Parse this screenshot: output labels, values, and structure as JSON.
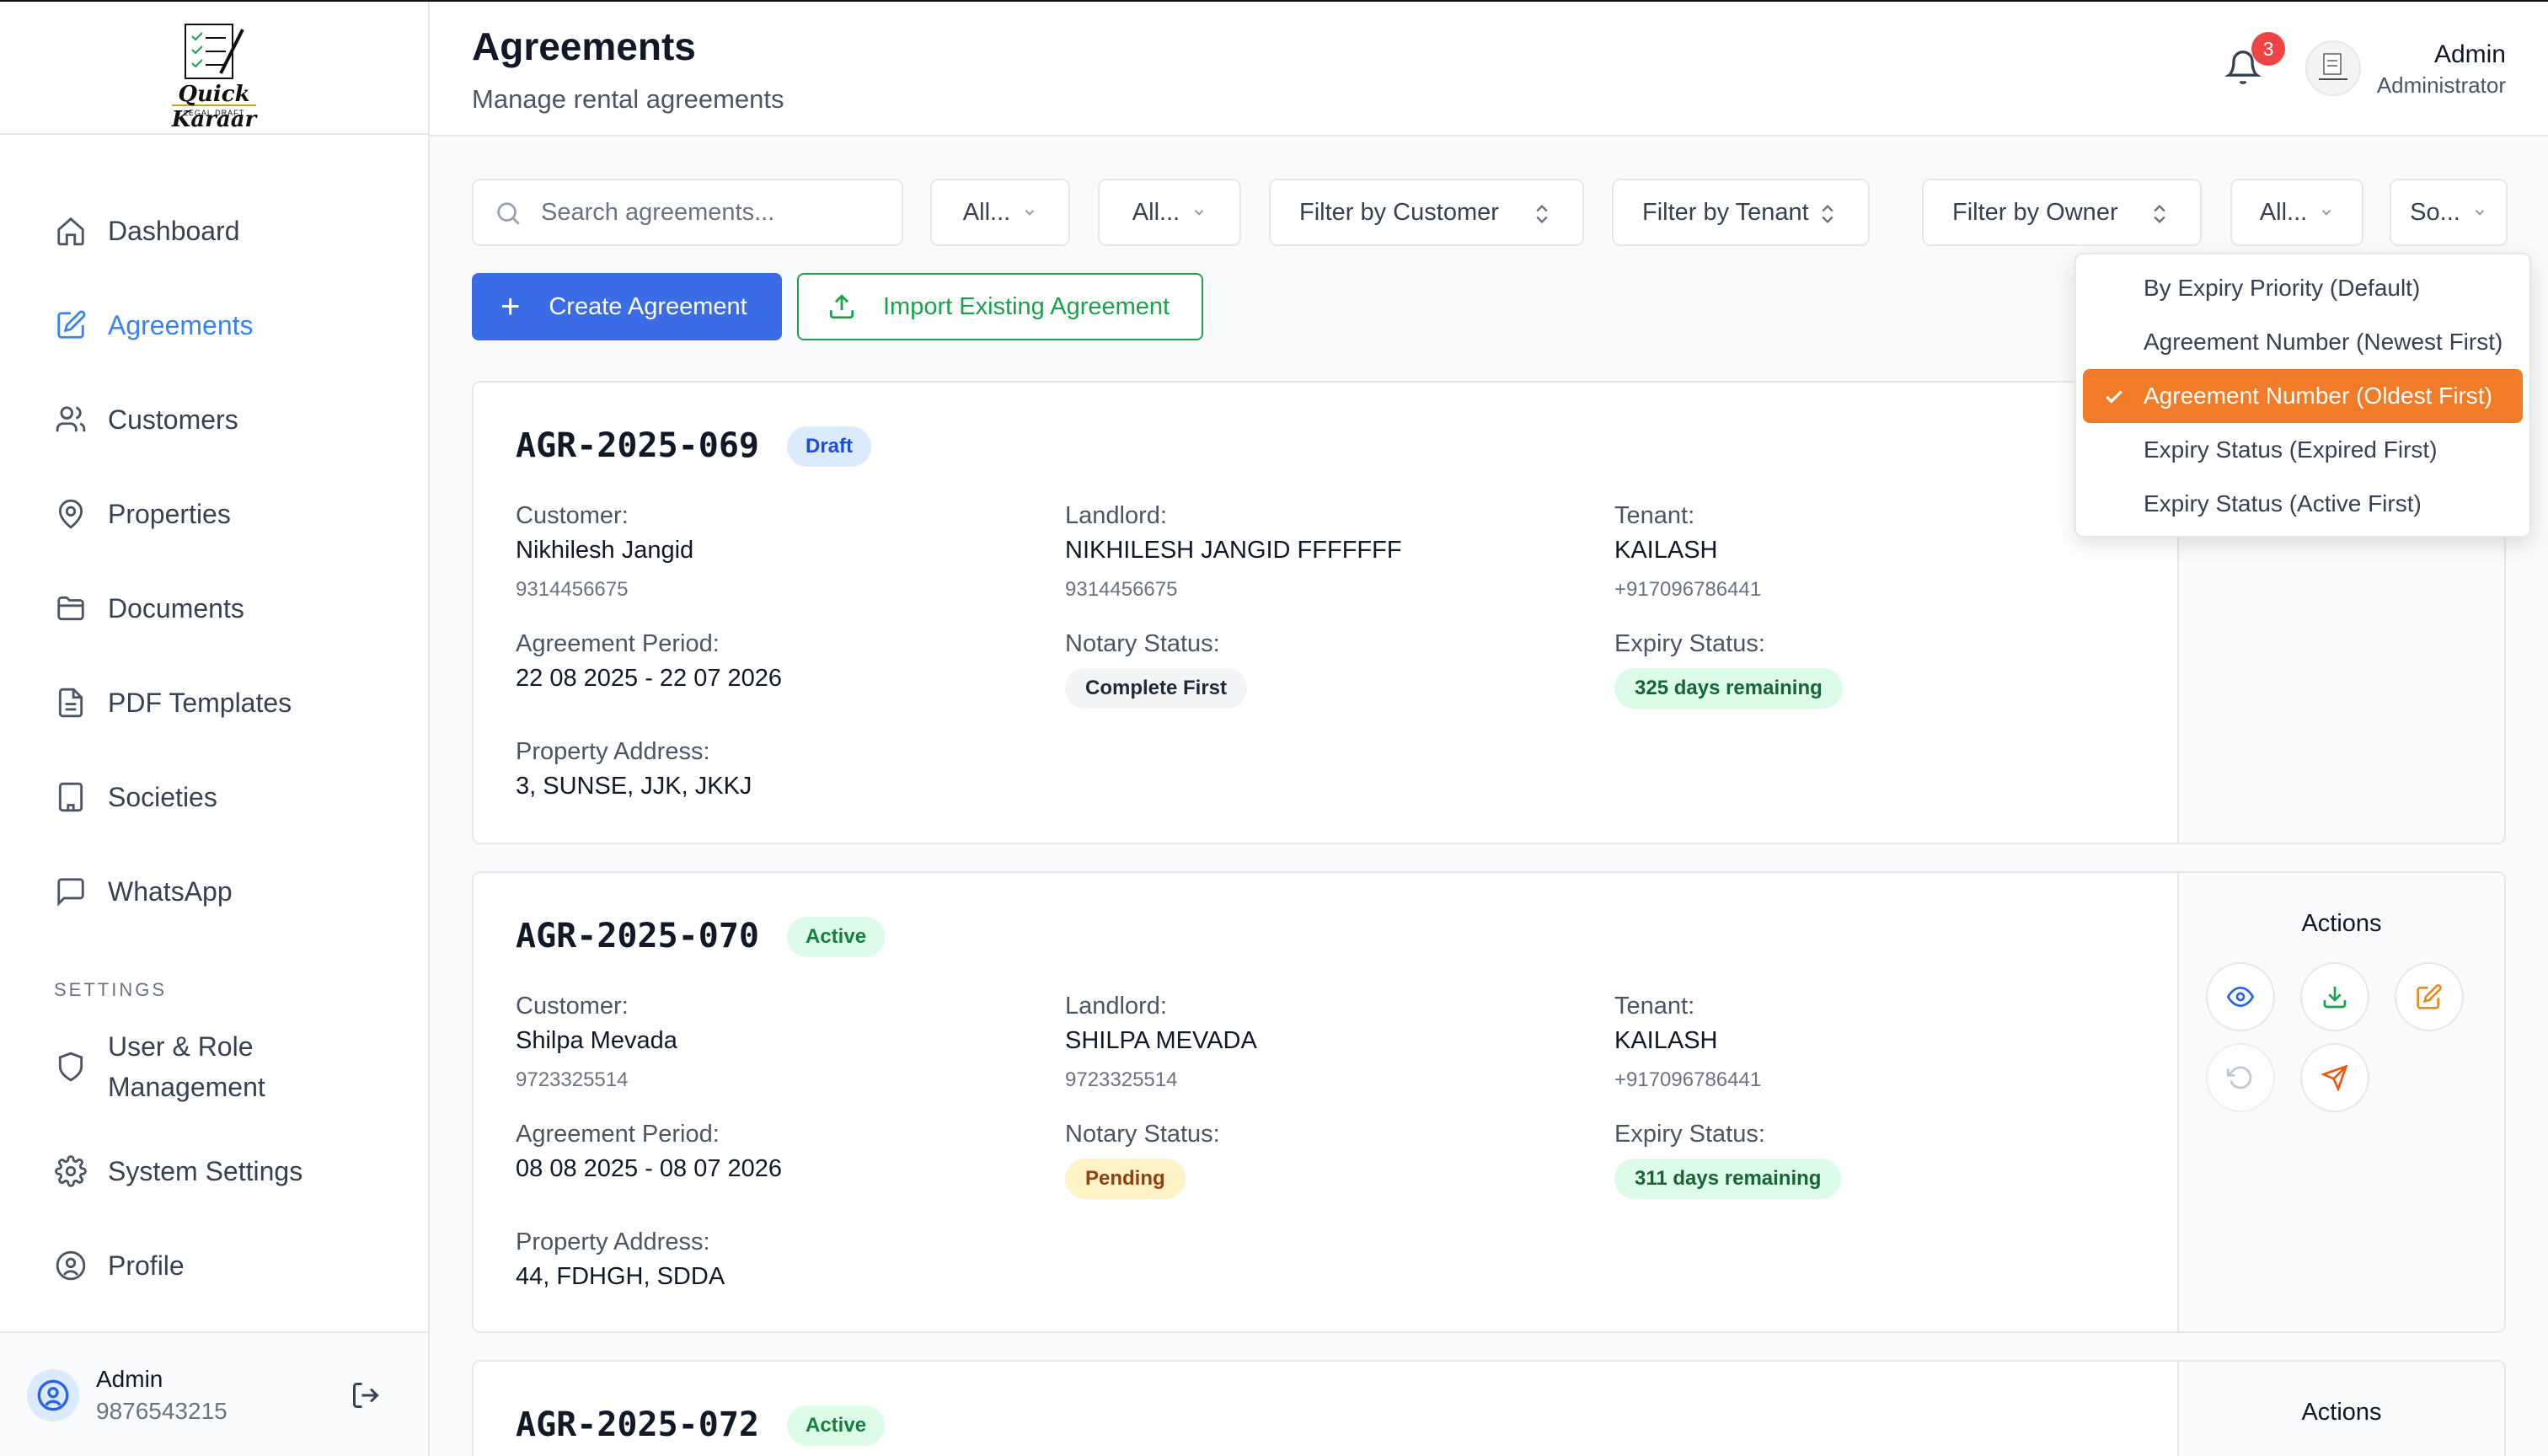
{
  "brand": {
    "logo_title": "Quick Karaar",
    "logo_subtitle": "LEGAL DRAFT"
  },
  "sidebar": {
    "items": [
      {
        "label": "Dashboard",
        "icon": "home-icon"
      },
      {
        "label": "Agreements",
        "icon": "edit-document-icon",
        "active": true
      },
      {
        "label": "Customers",
        "icon": "users-icon"
      },
      {
        "label": "Properties",
        "icon": "map-pin-icon"
      },
      {
        "label": "Documents",
        "icon": "folder-icon"
      },
      {
        "label": "PDF Templates",
        "icon": "file-text-icon"
      },
      {
        "label": "Societies",
        "icon": "building-icon"
      },
      {
        "label": "WhatsApp",
        "icon": "message-icon"
      }
    ],
    "settings_label": "SETTINGS",
    "settings_items": [
      {
        "label": "User & Role Management",
        "icon": "shield-icon"
      },
      {
        "label": "System Settings",
        "icon": "gear-icon"
      },
      {
        "label": "Profile",
        "icon": "user-circle-icon"
      }
    ],
    "footer": {
      "name": "Admin",
      "phone": "9876543215"
    }
  },
  "header": {
    "title": "Agreements",
    "subtitle": "Manage rental agreements",
    "notification_count": "3",
    "user_name": "Admin",
    "user_role": "Administrator"
  },
  "filters": {
    "search_placeholder": "Search agreements...",
    "status": "All...",
    "notary": "All...",
    "customer": "Filter by Customer",
    "tenant": "Filter by Tenant",
    "owner": "Filter by Owner",
    "expiry": "All...",
    "sort": "So..."
  },
  "buttons": {
    "create": "Create Agreement",
    "import": "Import Existing Agreement"
  },
  "labels": {
    "customer": "Customer:",
    "landlord": "Landlord:",
    "tenant": "Tenant:",
    "period": "Agreement Period:",
    "notary": "Notary Status:",
    "expiry": "Expiry Status:",
    "address": "Property Address:",
    "actions": "Actions"
  },
  "agreements": [
    {
      "number": "AGR-2025-069",
      "status": "Draft",
      "customer_name": "Nikhilesh Jangid",
      "customer_phone": "9314456675",
      "landlord_name": "NIKHILESH JANGID FFFFFFF",
      "landlord_phone": "9314456675",
      "tenant_name": "KAILASH",
      "tenant_phone": "+917096786441",
      "period": "22 08 2025 - 22 07 2026",
      "notary_status": "Complete First",
      "expiry_status": "325 days remaining",
      "address": "3, SUNSE, JJK, JKKJ"
    },
    {
      "number": "AGR-2025-070",
      "status": "Active",
      "customer_name": "Shilpa Mevada",
      "customer_phone": "9723325514",
      "landlord_name": "SHILPA MEVADA",
      "landlord_phone": "9723325514",
      "tenant_name": "KAILASH",
      "tenant_phone": "+917096786441",
      "period": "08 08 2025 - 08 07 2026",
      "notary_status": "Pending",
      "expiry_status": "311 days remaining",
      "address": "44, FDHGH, SDDA"
    },
    {
      "number": "AGR-2025-072",
      "status": "Active"
    }
  ],
  "sort_menu": {
    "options": [
      "By Expiry Priority (Default)",
      "Agreement Number (Newest First)",
      "Agreement Number (Oldest First)",
      "Expiry Status (Expired First)",
      "Expiry Status (Active First)"
    ],
    "selected": "Agreement Number (Oldest First)"
  },
  "colors": {
    "primary": "#3b6ce8",
    "accent_orange": "#f07c2a",
    "success": "#16a34a",
    "danger": "#ef4444"
  }
}
